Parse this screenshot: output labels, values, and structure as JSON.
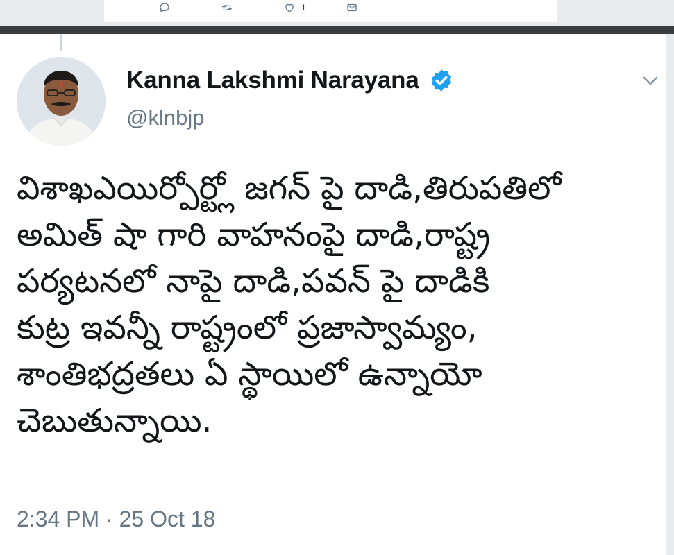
{
  "previous_tweet": {
    "actions": [
      {
        "icon": "reply-icon"
      },
      {
        "icon": "retweet-icon"
      },
      {
        "icon": "like-icon",
        "count": "1"
      },
      {
        "icon": "direct-message-icon"
      }
    ]
  },
  "tweet": {
    "author_name": "Kanna Lakshmi Narayana",
    "verified": true,
    "handle": "@klnbjp",
    "text": "విశాఖఎయిర్పోర్ట్లో జగన్ పై దాడి,తిరుపతిలో\nఅమిత్ షా గారి వాహనంపై దాడి,రాష్ట్ర\nపర్యటనలో నాపై దాడి,పవన్ పై దాడికి\nకుట్ర ఇవన్నీ రాష్ట్రంలో ప్రజాస్వామ్యం,\nశాంతిభద్రతలు ఏ స్థాయిలో ఉన్నాయో\nచెబుతున్నాయి.",
    "timestamp": "2:34 PM · 25 Oct 18"
  },
  "colors": {
    "text_primary": "#14171a",
    "text_secondary": "#657786",
    "verified_blue": "#1da1f2",
    "divider": "#3b3e41"
  }
}
